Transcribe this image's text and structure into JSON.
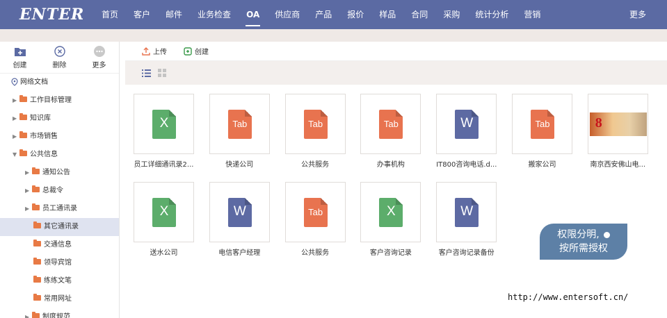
{
  "header": {
    "logo": "ENTER",
    "nav": [
      {
        "label": "首页",
        "active": false
      },
      {
        "label": "客户",
        "active": false
      },
      {
        "label": "邮件",
        "active": false
      },
      {
        "label": "业务检查",
        "active": false
      },
      {
        "label": "OA",
        "active": true
      },
      {
        "label": "供应商",
        "active": false
      },
      {
        "label": "产品",
        "active": false
      },
      {
        "label": "报价",
        "active": false
      },
      {
        "label": "样品",
        "active": false
      },
      {
        "label": "合同",
        "active": false
      },
      {
        "label": "采购",
        "active": false
      },
      {
        "label": "统计分析",
        "active": false
      },
      {
        "label": "营销",
        "active": false
      }
    ],
    "more": "更多",
    "bg_color": "#5b6aa3"
  },
  "sidebar": {
    "tools": [
      {
        "label": "创建",
        "icon": "folder-add-icon"
      },
      {
        "label": "删除",
        "icon": "delete-circle-icon"
      },
      {
        "label": "更多",
        "icon": "more-circle-icon"
      }
    ],
    "root": {
      "label": "网络文档",
      "icon": "location-pin-icon"
    },
    "tree": [
      {
        "label": "工作目标管理",
        "level": 1,
        "expanded": false,
        "selected": false
      },
      {
        "label": "知识库",
        "level": 1,
        "expanded": false,
        "selected": false
      },
      {
        "label": "市场销售",
        "level": 1,
        "expanded": false,
        "selected": false
      },
      {
        "label": "公共信息",
        "level": 1,
        "expanded": true,
        "selected": false
      },
      {
        "label": "通知公告",
        "level": 2,
        "expanded": false,
        "selected": false
      },
      {
        "label": "总裁令",
        "level": 2,
        "expanded": false,
        "selected": false
      },
      {
        "label": "员工通讯录",
        "level": 2,
        "expanded": false,
        "selected": false
      },
      {
        "label": "其它通讯录",
        "level": 2,
        "leaf": true,
        "selected": true
      },
      {
        "label": "交通信息",
        "level": 2,
        "leaf": true,
        "selected": false
      },
      {
        "label": "领导宾馆",
        "level": 2,
        "leaf": true,
        "selected": false
      },
      {
        "label": "练练文笔",
        "level": 2,
        "leaf": true,
        "selected": false
      },
      {
        "label": "常用网址",
        "level": 2,
        "leaf": true,
        "selected": false
      },
      {
        "label": "制度规范",
        "level": 2,
        "expanded": false,
        "selected": false
      }
    ],
    "selected_color": "#dfe3f0"
  },
  "toolbar": {
    "upload": "上传",
    "create": "创建"
  },
  "files": [
    {
      "name": "员工详细通讯录2...",
      "type": "x",
      "label": "X"
    },
    {
      "name": "快递公司",
      "type": "tab",
      "label": "Tab"
    },
    {
      "name": "公共服务",
      "type": "tab",
      "label": "Tab"
    },
    {
      "name": "办事机构",
      "type": "tab",
      "label": "Tab"
    },
    {
      "name": "IT800咨询电话.d...",
      "type": "w",
      "label": "W"
    },
    {
      "name": "搬家公司",
      "type": "tab",
      "label": "Tab"
    },
    {
      "name": "南京西安佛山电...",
      "type": "image",
      "label": "8"
    },
    {
      "name": "送水公司",
      "type": "x",
      "label": "X"
    },
    {
      "name": "电信客户经理",
      "type": "w",
      "label": "W"
    },
    {
      "name": "公共服务",
      "type": "tab",
      "label": "Tab"
    },
    {
      "name": "客户咨询记录",
      "type": "x",
      "label": "X"
    },
    {
      "name": "客户咨询记录备份",
      "type": "w",
      "label": "W"
    }
  ],
  "colors": {
    "excel": "#5cad6b",
    "word": "#5d6aa3",
    "tab": "#e8734f",
    "badge": "#5d80a6"
  },
  "badge": {
    "line1": "权限分明,",
    "line2": "按所需授权"
  },
  "watermark": "http://www.entersoft.cn/"
}
